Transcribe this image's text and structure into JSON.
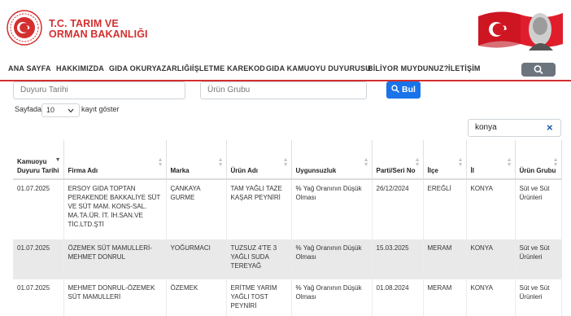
{
  "header": {
    "brand_line1": "T.C. TARIM VE",
    "brand_line2": "ORMAN BAKANLIĞI"
  },
  "nav": {
    "items": [
      "ANA SAYFA",
      "HAKKIMIZDA",
      "GIDA OKURYAZARLIĞI",
      "İŞLETME KAREKOD",
      "GIDA KAMUOYU DUYURUSU",
      "BİLİYOR MUYDUNUZ?",
      "İLETİŞİM"
    ],
    "search_icon": "search-icon"
  },
  "filters": {
    "date_placeholder": "Duyuru Tarihi",
    "group_placeholder": "Ürün Grubu",
    "search_button": "Bul"
  },
  "length": {
    "prefix": "Sayfada",
    "value": "10",
    "suffix": "kayıt göster"
  },
  "table_search": {
    "value": "konya",
    "clear": "×"
  },
  "table": {
    "headers": [
      "Kamuoyu Duyuru Tarihi",
      "Firma Adı",
      "Marka",
      "Ürün Adı",
      "Uygunsuzluk",
      "Parti/Seri No",
      "İlçe",
      "İl",
      "Ürün Grubu"
    ],
    "rows": [
      [
        "01.07.2025",
        "ERSOY GIDA TOPTAN PERAKENDE BAKKALİYE SÜT VE SÜT MAM. KONS-SAL. MA.TA.ÜR. İT. İH.SAN.VE TİC.LTD.ŞTİ",
        "ÇANKAYA GURME",
        "TAM YAĞLI TAZE KAŞAR PEYNİRİ",
        "% Yağ Oranının Düşük Olması",
        "26/12/2024",
        "EREĞLİ",
        "KONYA",
        "Süt ve Süt Ürünleri"
      ],
      [
        "01.07.2025",
        "ÖZEMEK SÜT MAMULLERİ-MEHMET DONRUL",
        "YOĞURMACI",
        "TUZSUZ 4'TE 3 YAĞLI SUDA TEREYAĞ",
        "% Yağ Oranının Düşük Olması",
        "15.03.2025",
        "MERAM",
        "KONYA",
        "Süt ve Süt Ürünleri"
      ],
      [
        "01.07.2025",
        "MEHMET DONRUL-ÖZEMEK SÜT MAMULLERİ",
        "ÖZEMEK",
        "ERİTME YARIM YAĞLI TOST PEYNİRİ",
        "% Yağ Oranının Düşük Olması",
        "01.08.2024",
        "MERAM",
        "KONYA",
        "Süt ve Süt Ürünleri"
      ]
    ]
  }
}
